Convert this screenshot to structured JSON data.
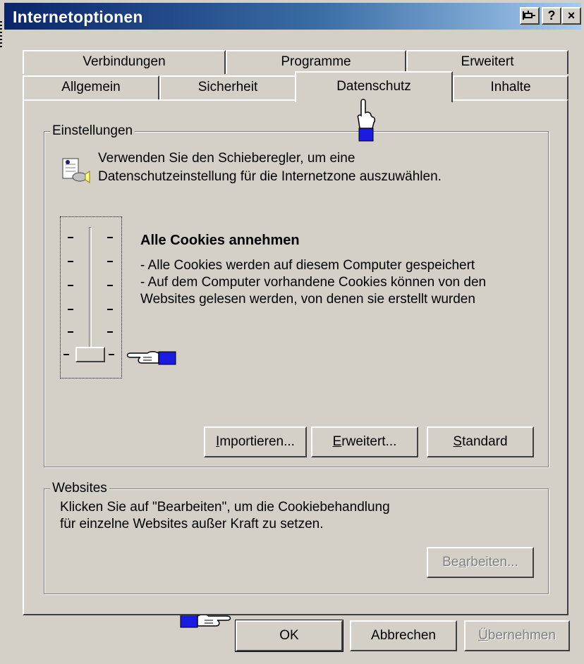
{
  "window": {
    "title": "Internetoptionen",
    "pin_button": "⌥",
    "help_button": "?",
    "close_button": "×"
  },
  "tabs": {
    "row_back": [
      "Verbindungen",
      "Programme",
      "Erweitert"
    ],
    "row_front": [
      "Allgemein",
      "Sicherheit",
      "Datenschutz",
      "Inhalte"
    ],
    "active": "Datenschutz"
  },
  "settings_group": {
    "legend": "Einstellungen",
    "intro_line1": "Verwenden Sie den Schieberegler, um eine",
    "intro_line2": "Datenschutzeinstellung für die Internetzone auszuwählen.",
    "level_title": "Alle Cookies annehmen",
    "level_desc1": "- Alle Cookies werden auf diesem Computer gespeichert",
    "level_desc2": "- Auf dem Computer vorhandene Cookies können von den",
    "level_desc3": "Websites gelesen werden, von denen sie erstellt wurden",
    "slider_position": "lowest",
    "buttons": {
      "import_pre": "",
      "import_ul": "I",
      "import_post": "mportieren...",
      "advanced_pre": "",
      "advanced_ul": "E",
      "advanced_post": "rweitert...",
      "default_pre": "",
      "default_ul": "S",
      "default_post": "tandard"
    }
  },
  "websites_group": {
    "legend": "Websites",
    "text_line1": "Klicken Sie auf \"Bearbeiten\", um die Cookiebehandlung",
    "text_line2": "für einzelne Websites außer Kraft zu setzen.",
    "edit_pre": "Be",
    "edit_ul": "a",
    "edit_post": "rbeiten..."
  },
  "footer": {
    "ok": "OK",
    "cancel": "Abbrechen",
    "apply_pre": "",
    "apply_ul": "Ü",
    "apply_post": "bernehmen"
  },
  "colors": {
    "face": "#d4d0c8",
    "titlebar_start": "#0a246a",
    "titlebar_end": "#a6caf0",
    "hand_cuff": "#1a1ae0"
  }
}
